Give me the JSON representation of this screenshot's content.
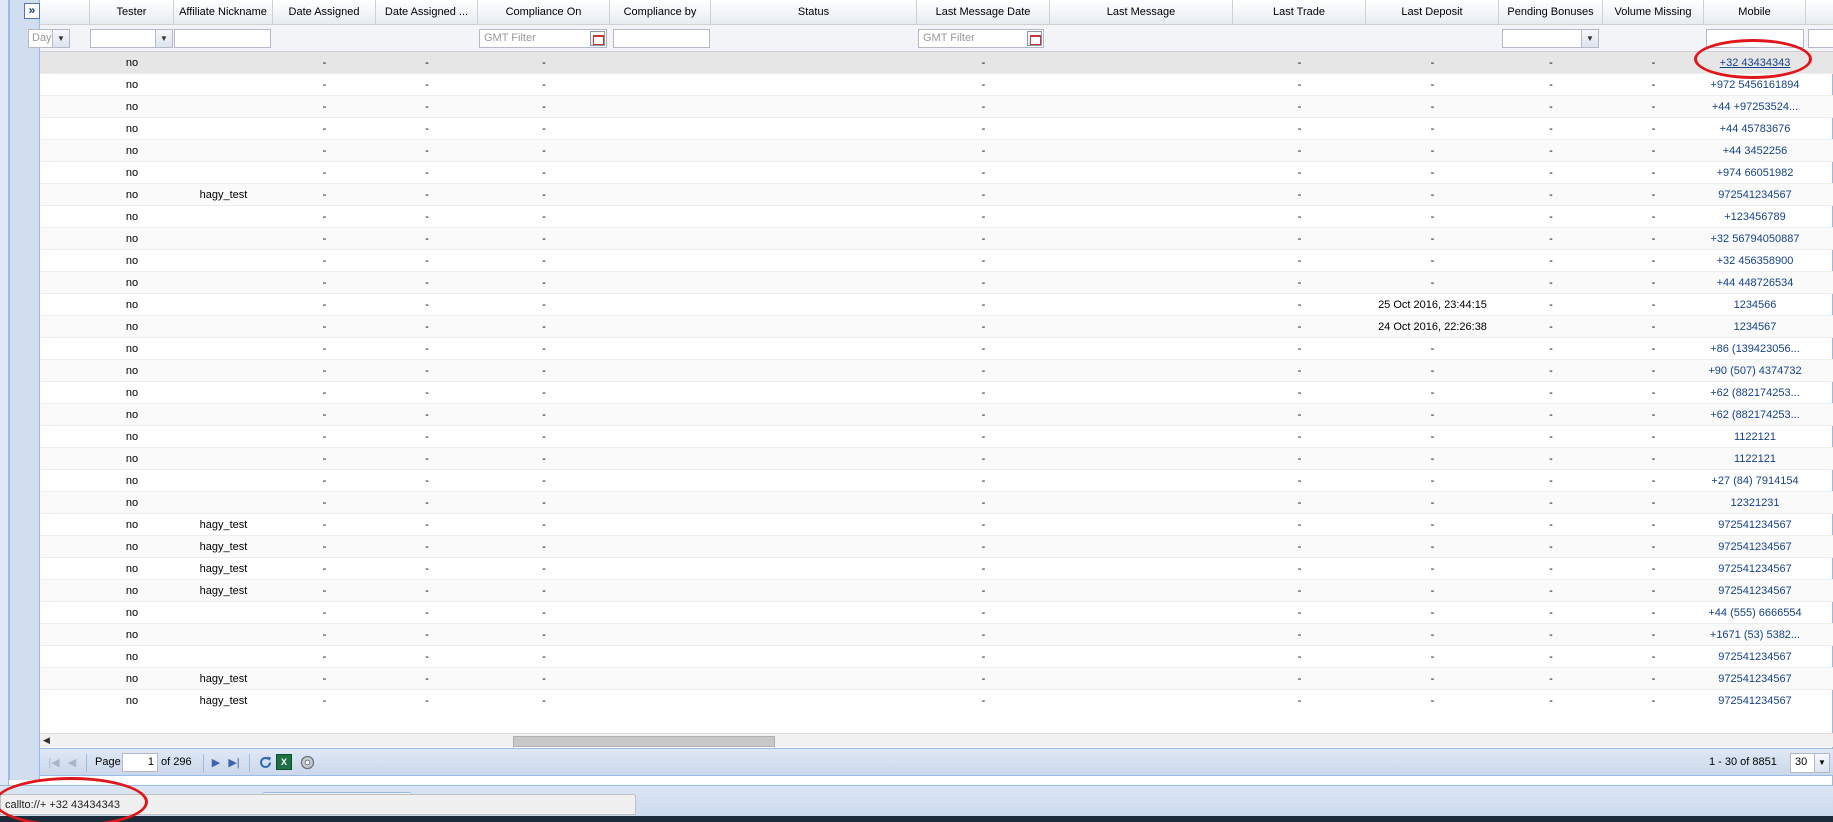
{
  "expand_button": "»",
  "columns": [
    {
      "key": "c0",
      "label": ""
    },
    {
      "key": "tester",
      "label": "Tester"
    },
    {
      "key": "affiliate",
      "label": "Affiliate Nickname"
    },
    {
      "key": "date_assigned",
      "label": "Date Assigned"
    },
    {
      "key": "date_assigned2",
      "label": "Date Assigned ..."
    },
    {
      "key": "compliance_on",
      "label": "Compliance On"
    },
    {
      "key": "compliance_by",
      "label": "Compliance by"
    },
    {
      "key": "status",
      "label": "Status"
    },
    {
      "key": "last_message_date",
      "label": "Last Message Date"
    },
    {
      "key": "last_message",
      "label": "Last Message"
    },
    {
      "key": "last_trade",
      "label": "Last Trade"
    },
    {
      "key": "last_deposit",
      "label": "Last Deposit"
    },
    {
      "key": "pending_bonuses",
      "label": "Pending Bonuses"
    },
    {
      "key": "volume_missing",
      "label": "Volume Missing"
    },
    {
      "key": "mobile",
      "label": "Mobile"
    },
    {
      "key": "c15",
      "label": ""
    }
  ],
  "filters": {
    "day_combo": "Day",
    "gmt_placeholder": "GMT Filter"
  },
  "rows": [
    {
      "tester": "no",
      "affiliate": "",
      "date_assigned": "-",
      "date_assigned2": "-",
      "compliance_on": "-",
      "last_message_date": "-",
      "last_trade": "-",
      "last_deposit": "-",
      "pending_bonuses": "-",
      "volume_missing": "-",
      "mobile": "+32 43434343"
    },
    {
      "tester": "no",
      "affiliate": "",
      "date_assigned": "-",
      "date_assigned2": "-",
      "compliance_on": "-",
      "last_message_date": "-",
      "last_trade": "-",
      "last_deposit": "-",
      "pending_bonuses": "-",
      "volume_missing": "-",
      "mobile": "+972 5456161894"
    },
    {
      "tester": "no",
      "affiliate": "",
      "date_assigned": "-",
      "date_assigned2": "-",
      "compliance_on": "-",
      "last_message_date": "-",
      "last_trade": "-",
      "last_deposit": "-",
      "pending_bonuses": "-",
      "volume_missing": "-",
      "mobile": "+44 +97253524..."
    },
    {
      "tester": "no",
      "affiliate": "",
      "date_assigned": "-",
      "date_assigned2": "-",
      "compliance_on": "-",
      "last_message_date": "-",
      "last_trade": "-",
      "last_deposit": "-",
      "pending_bonuses": "-",
      "volume_missing": "-",
      "mobile": "+44 45783676"
    },
    {
      "tester": "no",
      "affiliate": "",
      "date_assigned": "-",
      "date_assigned2": "-",
      "compliance_on": "-",
      "last_message_date": "-",
      "last_trade": "-",
      "last_deposit": "-",
      "pending_bonuses": "-",
      "volume_missing": "-",
      "mobile": "+44 3452256"
    },
    {
      "tester": "no",
      "affiliate": "",
      "date_assigned": "-",
      "date_assigned2": "-",
      "compliance_on": "-",
      "last_message_date": "-",
      "last_trade": "-",
      "last_deposit": "-",
      "pending_bonuses": "-",
      "volume_missing": "-",
      "mobile": "+974 66051982"
    },
    {
      "tester": "no",
      "affiliate": "hagy_test",
      "date_assigned": "-",
      "date_assigned2": "-",
      "compliance_on": "-",
      "last_message_date": "-",
      "last_trade": "-",
      "last_deposit": "-",
      "pending_bonuses": "-",
      "volume_missing": "-",
      "mobile": "972541234567"
    },
    {
      "tester": "no",
      "affiliate": "",
      "date_assigned": "-",
      "date_assigned2": "-",
      "compliance_on": "-",
      "last_message_date": "-",
      "last_trade": "-",
      "last_deposit": "-",
      "pending_bonuses": "-",
      "volume_missing": "-",
      "mobile": "+123456789"
    },
    {
      "tester": "no",
      "affiliate": "",
      "date_assigned": "-",
      "date_assigned2": "-",
      "compliance_on": "-",
      "last_message_date": "-",
      "last_trade": "-",
      "last_deposit": "-",
      "pending_bonuses": "-",
      "volume_missing": "-",
      "mobile": "+32 56794050887"
    },
    {
      "tester": "no",
      "affiliate": "",
      "date_assigned": "-",
      "date_assigned2": "-",
      "compliance_on": "-",
      "last_message_date": "-",
      "last_trade": "-",
      "last_deposit": "-",
      "pending_bonuses": "-",
      "volume_missing": "-",
      "mobile": "+32 456358900"
    },
    {
      "tester": "no",
      "affiliate": "",
      "date_assigned": "-",
      "date_assigned2": "-",
      "compliance_on": "-",
      "last_message_date": "-",
      "last_trade": "-",
      "last_deposit": "-",
      "pending_bonuses": "-",
      "volume_missing": "-",
      "mobile": "+44 448726534"
    },
    {
      "tester": "no",
      "affiliate": "",
      "date_assigned": "-",
      "date_assigned2": "-",
      "compliance_on": "-",
      "last_message_date": "-",
      "last_trade": "-",
      "last_deposit": "25 Oct 2016, 23:44:15",
      "pending_bonuses": "-",
      "volume_missing": "-",
      "mobile": "1234566"
    },
    {
      "tester": "no",
      "affiliate": "",
      "date_assigned": "-",
      "date_assigned2": "-",
      "compliance_on": "-",
      "last_message_date": "-",
      "last_trade": "-",
      "last_deposit": "24 Oct 2016, 22:26:38",
      "pending_bonuses": "-",
      "volume_missing": "-",
      "mobile": "1234567"
    },
    {
      "tester": "no",
      "affiliate": "",
      "date_assigned": "-",
      "date_assigned2": "-",
      "compliance_on": "-",
      "last_message_date": "-",
      "last_trade": "-",
      "last_deposit": "-",
      "pending_bonuses": "-",
      "volume_missing": "-",
      "mobile": "+86 (139423056..."
    },
    {
      "tester": "no",
      "affiliate": "",
      "date_assigned": "-",
      "date_assigned2": "-",
      "compliance_on": "-",
      "last_message_date": "-",
      "last_trade": "-",
      "last_deposit": "-",
      "pending_bonuses": "-",
      "volume_missing": "-",
      "mobile": "+90 (507) 4374732"
    },
    {
      "tester": "no",
      "affiliate": "",
      "date_assigned": "-",
      "date_assigned2": "-",
      "compliance_on": "-",
      "last_message_date": "-",
      "last_trade": "-",
      "last_deposit": "-",
      "pending_bonuses": "-",
      "volume_missing": "-",
      "mobile": "+62 (882174253..."
    },
    {
      "tester": "no",
      "affiliate": "",
      "date_assigned": "-",
      "date_assigned2": "-",
      "compliance_on": "-",
      "last_message_date": "-",
      "last_trade": "-",
      "last_deposit": "-",
      "pending_bonuses": "-",
      "volume_missing": "-",
      "mobile": "+62 (882174253..."
    },
    {
      "tester": "no",
      "affiliate": "",
      "date_assigned": "-",
      "date_assigned2": "-",
      "compliance_on": "-",
      "last_message_date": "-",
      "last_trade": "-",
      "last_deposit": "-",
      "pending_bonuses": "-",
      "volume_missing": "-",
      "mobile": "1122121"
    },
    {
      "tester": "no",
      "affiliate": "",
      "date_assigned": "-",
      "date_assigned2": "-",
      "compliance_on": "-",
      "last_message_date": "-",
      "last_trade": "-",
      "last_deposit": "-",
      "pending_bonuses": "-",
      "volume_missing": "-",
      "mobile": "1122121"
    },
    {
      "tester": "no",
      "affiliate": "",
      "date_assigned": "-",
      "date_assigned2": "-",
      "compliance_on": "-",
      "last_message_date": "-",
      "last_trade": "-",
      "last_deposit": "-",
      "pending_bonuses": "-",
      "volume_missing": "-",
      "mobile": "+27 (84) 7914154"
    },
    {
      "tester": "no",
      "affiliate": "",
      "date_assigned": "-",
      "date_assigned2": "-",
      "compliance_on": "-",
      "last_message_date": "-",
      "last_trade": "-",
      "last_deposit": "-",
      "pending_bonuses": "-",
      "volume_missing": "-",
      "mobile": "12321231"
    },
    {
      "tester": "no",
      "affiliate": "hagy_test",
      "date_assigned": "-",
      "date_assigned2": "-",
      "compliance_on": "-",
      "last_message_date": "-",
      "last_trade": "-",
      "last_deposit": "-",
      "pending_bonuses": "-",
      "volume_missing": "-",
      "mobile": "972541234567"
    },
    {
      "tester": "no",
      "affiliate": "hagy_test",
      "date_assigned": "-",
      "date_assigned2": "-",
      "compliance_on": "-",
      "last_message_date": "-",
      "last_trade": "-",
      "last_deposit": "-",
      "pending_bonuses": "-",
      "volume_missing": "-",
      "mobile": "972541234567"
    },
    {
      "tester": "no",
      "affiliate": "hagy_test",
      "date_assigned": "-",
      "date_assigned2": "-",
      "compliance_on": "-",
      "last_message_date": "-",
      "last_trade": "-",
      "last_deposit": "-",
      "pending_bonuses": "-",
      "volume_missing": "-",
      "mobile": "972541234567"
    },
    {
      "tester": "no",
      "affiliate": "hagy_test",
      "date_assigned": "-",
      "date_assigned2": "-",
      "compliance_on": "-",
      "last_message_date": "-",
      "last_trade": "-",
      "last_deposit": "-",
      "pending_bonuses": "-",
      "volume_missing": "-",
      "mobile": "972541234567"
    },
    {
      "tester": "no",
      "affiliate": "",
      "date_assigned": "-",
      "date_assigned2": "-",
      "compliance_on": "-",
      "last_message_date": "-",
      "last_trade": "-",
      "last_deposit": "-",
      "pending_bonuses": "-",
      "volume_missing": "-",
      "mobile": "+44 (555) 6666554"
    },
    {
      "tester": "no",
      "affiliate": "",
      "date_assigned": "-",
      "date_assigned2": "-",
      "compliance_on": "-",
      "last_message_date": "-",
      "last_trade": "-",
      "last_deposit": "-",
      "pending_bonuses": "-",
      "volume_missing": "-",
      "mobile": "+1671 (53) 5382..."
    },
    {
      "tester": "no",
      "affiliate": "",
      "date_assigned": "-",
      "date_assigned2": "-",
      "compliance_on": "-",
      "last_message_date": "-",
      "last_trade": "-",
      "last_deposit": "-",
      "pending_bonuses": "-",
      "volume_missing": "-",
      "mobile": "972541234567"
    },
    {
      "tester": "no",
      "affiliate": "hagy_test",
      "date_assigned": "-",
      "date_assigned2": "-",
      "compliance_on": "-",
      "last_message_date": "-",
      "last_trade": "-",
      "last_deposit": "-",
      "pending_bonuses": "-",
      "volume_missing": "-",
      "mobile": "972541234567"
    },
    {
      "tester": "no",
      "affiliate": "hagy_test",
      "date_assigned": "-",
      "date_assigned2": "-",
      "compliance_on": "-",
      "last_message_date": "-",
      "last_trade": "-",
      "last_deposit": "-",
      "pending_bonuses": "-",
      "volume_missing": "-",
      "mobile": "972541234567"
    }
  ],
  "pager": {
    "page_label": "Page",
    "page_value": "1",
    "of_label": "of 296",
    "display_info": "1 - 30 of 8851",
    "page_size": "30",
    "excel_label": "X"
  },
  "status_bar": {
    "text": "callto://+ +32 43434343"
  },
  "colors": {
    "accent": "#15428b",
    "annotation": "#e0161b"
  }
}
